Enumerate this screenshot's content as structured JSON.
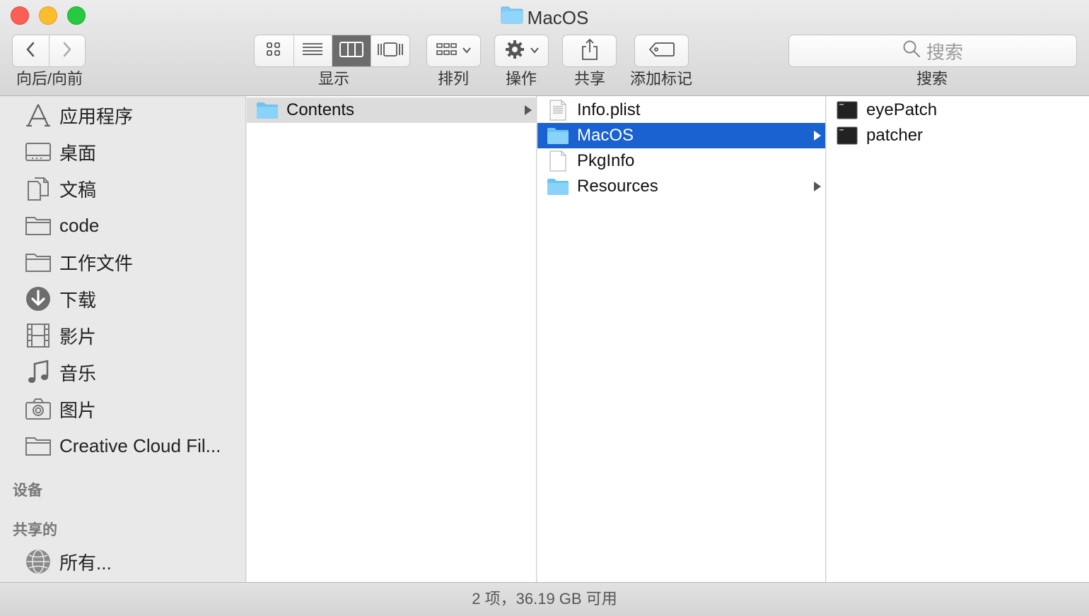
{
  "window": {
    "title": "MacOS"
  },
  "toolbar": {
    "nav_label": "向后/向前",
    "view_label": "显示",
    "arrange_label": "排列",
    "action_label": "操作",
    "share_label": "共享",
    "tags_label": "添加标记",
    "search_label": "搜索",
    "search_placeholder": "搜索",
    "active_view": "columns"
  },
  "sidebar": {
    "favorites": [
      {
        "label": "应用程序",
        "icon": "applications-icon"
      },
      {
        "label": "桌面",
        "icon": "desktop-icon"
      },
      {
        "label": "文稿",
        "icon": "documents-icon"
      },
      {
        "label": "code",
        "icon": "folder-icon"
      },
      {
        "label": "工作文件",
        "icon": "folder-icon"
      },
      {
        "label": "下载",
        "icon": "downloads-icon"
      },
      {
        "label": "影片",
        "icon": "movies-icon"
      },
      {
        "label": "音乐",
        "icon": "music-icon"
      },
      {
        "label": "图片",
        "icon": "pictures-icon"
      },
      {
        "label": "Creative Cloud Fil...",
        "icon": "folder-icon"
      }
    ],
    "devices_header": "设备",
    "shared_header": "共享的",
    "shared_items": [
      {
        "label": "所有...",
        "icon": "network-icon"
      }
    ]
  },
  "columns": [
    {
      "items": [
        {
          "name": "Contents",
          "kind": "folder",
          "state": "inactive-selected"
        }
      ]
    },
    {
      "items": [
        {
          "name": "Info.plist",
          "kind": "plist"
        },
        {
          "name": "MacOS",
          "kind": "folder",
          "state": "selected"
        },
        {
          "name": "PkgInfo",
          "kind": "document"
        },
        {
          "name": "Resources",
          "kind": "folder"
        }
      ]
    },
    {
      "items": [
        {
          "name": "eyePatch",
          "kind": "executable"
        },
        {
          "name": "patcher",
          "kind": "executable"
        }
      ]
    }
  ],
  "status": {
    "text": "2 项，36.19 GB 可用"
  },
  "colors": {
    "selection": "#1a62d0",
    "folder": "#6cc3f2",
    "sidebar_bg": "#e9e9e9"
  }
}
